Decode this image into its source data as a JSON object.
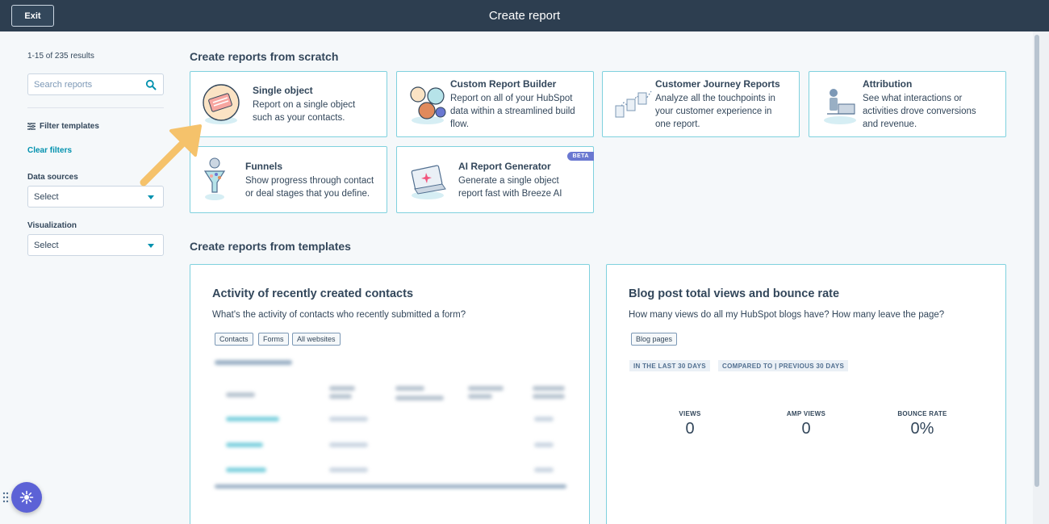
{
  "header": {
    "exit_label": "Exit",
    "title": "Create report"
  },
  "sidebar": {
    "result_count": "1-15 of 235 results",
    "search_placeholder": "Search reports",
    "filter_templates": "Filter templates",
    "clear_filters": "Clear filters",
    "data_sources_label": "Data sources",
    "data_sources_value": "Select",
    "visualization_label": "Visualization",
    "visualization_value": "Select"
  },
  "scratch": {
    "title": "Create reports from scratch",
    "cards": [
      {
        "title": "Single object",
        "desc": "Report on a single object such as your contacts."
      },
      {
        "title": "Custom Report Builder",
        "desc": "Report on all of your HubSpot data within a streamlined build flow."
      },
      {
        "title": "Customer Journey Reports",
        "desc": "Analyze all the touchpoints in your customer experience in one report."
      },
      {
        "title": "Attribution",
        "desc": "See what interactions or activities drove conversions and revenue."
      },
      {
        "title": "Funnels",
        "desc": "Show progress through contact or deal stages that you define."
      },
      {
        "title": "AI Report Generator",
        "desc": "Generate a single object report fast with Breeze AI",
        "badge": "BETA"
      }
    ]
  },
  "templates": {
    "title": "Create reports from templates",
    "activity": {
      "title": "Activity of recently created contacts",
      "question": "What's the activity of contacts who recently submitted a form?",
      "tags": [
        "Contacts",
        "Forms",
        "All websites"
      ]
    },
    "blog": {
      "title": "Blog post total views and bounce rate",
      "question": "How many views do all my HubSpot blogs have? How many leave the page?",
      "tags": [
        "Blog pages"
      ],
      "meta": [
        "IN THE LAST 30 DAYS",
        "COMPARED TO | PREVIOUS 30 DAYS"
      ],
      "kpis": [
        {
          "label": "VIEWS",
          "value": "0"
        },
        {
          "label": "AMP VIEWS",
          "value": "0"
        },
        {
          "label": "BOUNCE RATE",
          "value": "0%"
        }
      ]
    }
  },
  "colors": {
    "header_bg": "#2d3e50",
    "card_border": "#7fd1de",
    "link": "#0091ae",
    "annotation_arrow": "#f5c26b",
    "fab": "#5c62d6",
    "beta_badge": "#6a78d1"
  },
  "icons": {
    "search": "search-icon",
    "filter": "filter-icon",
    "caret": "caret-down-icon",
    "assistant": "assistant-icon",
    "drag": "drag-handle-icon"
  }
}
